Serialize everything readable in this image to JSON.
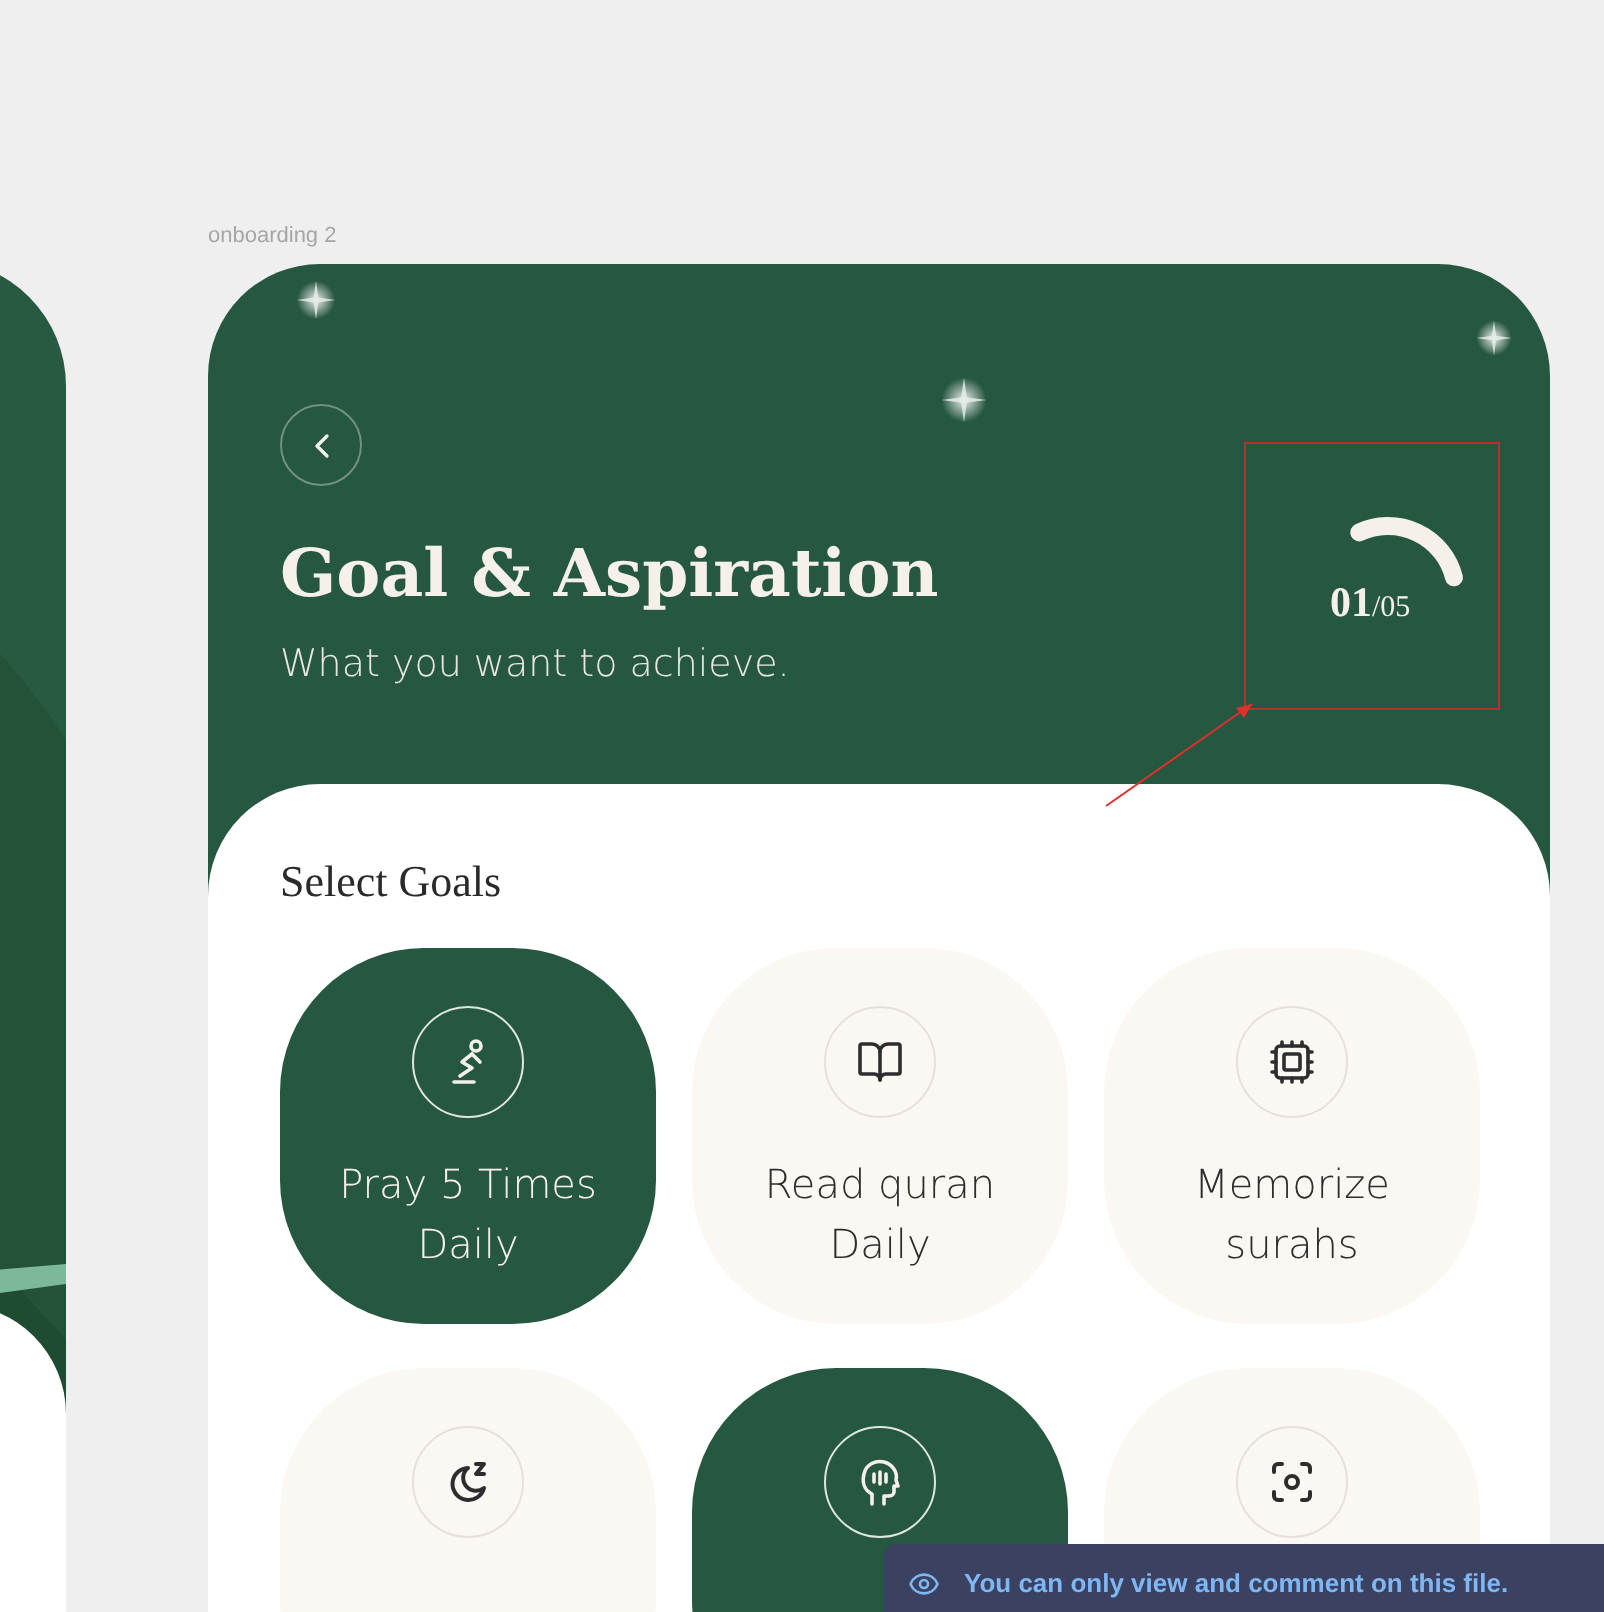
{
  "canvas": {
    "frame_label": "onboarding 2"
  },
  "header": {
    "title": "Goal & Aspiration",
    "subtitle": "What you want to achieve.",
    "progress": {
      "current": "01",
      "total": "/05"
    }
  },
  "section_title": "Select Goals",
  "goals": [
    {
      "label": "Pray 5 Times Daily",
      "selected": true
    },
    {
      "label": "Read quran Daily",
      "selected": false
    },
    {
      "label": "Memorize surahs",
      "selected": false
    },
    {
      "selected": false
    },
    {
      "selected": true
    },
    {
      "selected": false
    }
  ],
  "toast": {
    "text": "You can only view and comment on this file."
  }
}
